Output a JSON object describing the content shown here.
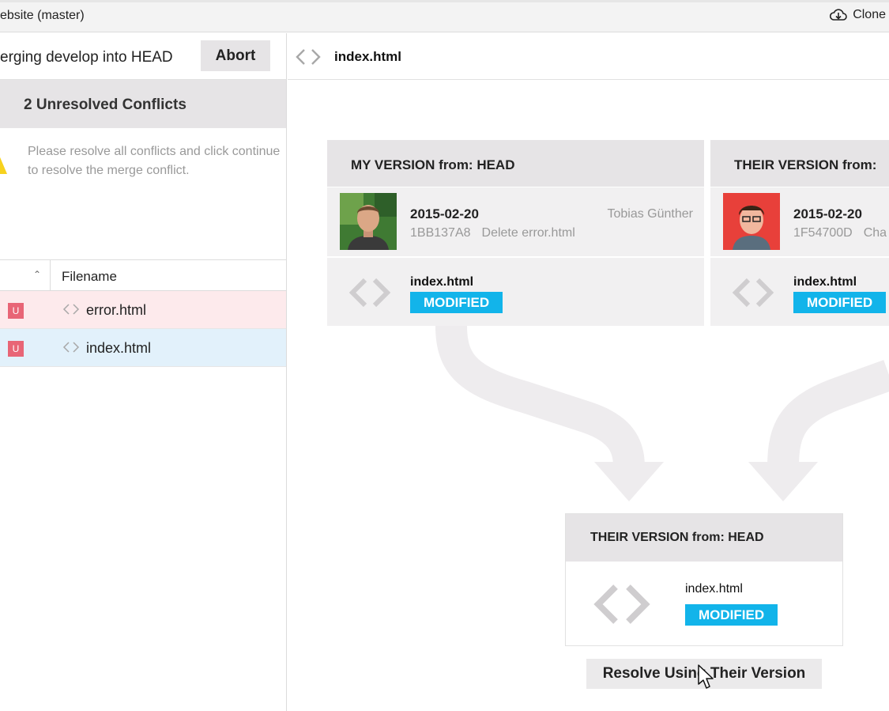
{
  "titlebar": {
    "title": "ebsite (master)",
    "clone_label": "Clone",
    "icon": "cloud-download-icon"
  },
  "merge": {
    "message": "erging develop into HEAD",
    "abort_label": "Abort"
  },
  "conflicts": {
    "header": "2 Unresolved Conflicts",
    "warning_text": "Please resolve all conflicts and click continue to resolve the merge conflict.",
    "warning_icon": "warning-icon"
  },
  "file_table": {
    "column_header": "Filename",
    "files": [
      {
        "status": "U",
        "name": "error.html",
        "selected": false
      },
      {
        "status": "U",
        "name": "index.html",
        "selected": true
      }
    ]
  },
  "detail": {
    "filename": "index.html",
    "mine": {
      "header": "MY VERSION from: HEAD",
      "date": "2015-02-20",
      "author": "Tobias Günther",
      "hash": "1BB137A8",
      "message": "Delete error.html",
      "file": "index.html",
      "status": "MODIFIED"
    },
    "theirs": {
      "header": "THEIR VERSION from:",
      "date": "2015-02-20",
      "hash": "1F54700D",
      "message": "Cha",
      "file": "index.html",
      "status": "MODIFIED"
    },
    "result": {
      "header": "THEIR VERSION from: HEAD",
      "file": "index.html",
      "status": "MODIFIED"
    },
    "resolve_label": "Resolve Using Their Version"
  },
  "colors": {
    "modified_badge": "#12b4ea",
    "unresolved_badge": "#e86576",
    "card_header": "#e6e4e6",
    "selected_row": "#e2f1fb",
    "conflict_row": "#fdeaec"
  }
}
